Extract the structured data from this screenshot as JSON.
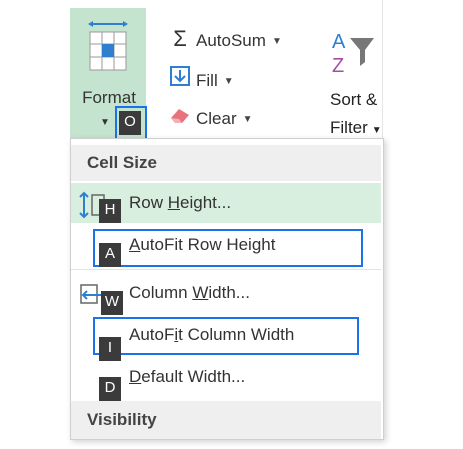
{
  "ribbon": {
    "format_label": "Format",
    "format_keytip": "O",
    "autosum_label": "AutoSum",
    "fill_label": "Fill",
    "clear_label": "Clear",
    "sort_line1": "Sort &",
    "sort_line2": "Filter",
    "icons": {
      "format": "format-grid-icon",
      "autosum": "sigma-icon",
      "fill": "fill-down-arrow-icon",
      "clear": "eraser-icon",
      "sort": "sort-az-funnel-icon"
    },
    "accent_color": "#c5e4cf"
  },
  "menu": {
    "header_cell_size": "Cell Size",
    "header_visibility": "Visibility",
    "items": [
      {
        "id": "row-height",
        "label": "Row Height...",
        "keytip": "H",
        "underline_char": "H",
        "highlighted": true
      },
      {
        "id": "autofit-row-height",
        "label": "AutoFit Row Height",
        "keytip": "A",
        "underline_char": "A",
        "outlined": true
      },
      {
        "id": "column-width",
        "label": "Column Width...",
        "keytip": "W",
        "underline_char": "W"
      },
      {
        "id": "autofit-column-width",
        "label": "AutoFit Column Width",
        "keytip": "I",
        "underline_char": "i",
        "outlined": true
      },
      {
        "id": "default-width",
        "label": "Default Width...",
        "keytip": "D",
        "underline_char": "D"
      }
    ],
    "highlight_color": "#d8eede",
    "outline_color": "#1a73e8"
  }
}
